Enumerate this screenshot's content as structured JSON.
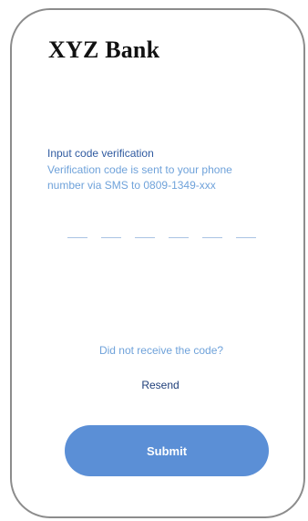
{
  "app": {
    "brand_name": "XYZ Bank"
  },
  "verification": {
    "title": "Input code verification",
    "description": "Verification code is sent to your phone number via SMS to 0809-1349-xxx",
    "code_slots": 6
  },
  "resend": {
    "prompt": "Did not receive the code?",
    "link_label": "Resend"
  },
  "actions": {
    "submit_label": "Submit"
  },
  "colors": {
    "frame_border": "#8c8c8c",
    "title_text": "#2f5aa0",
    "description_text": "#6fa2da",
    "code_underline": "#a9c3e3",
    "resend_link": "#1f3f7a",
    "submit_background": "#5b8fd6",
    "submit_text": "#ffffff"
  }
}
